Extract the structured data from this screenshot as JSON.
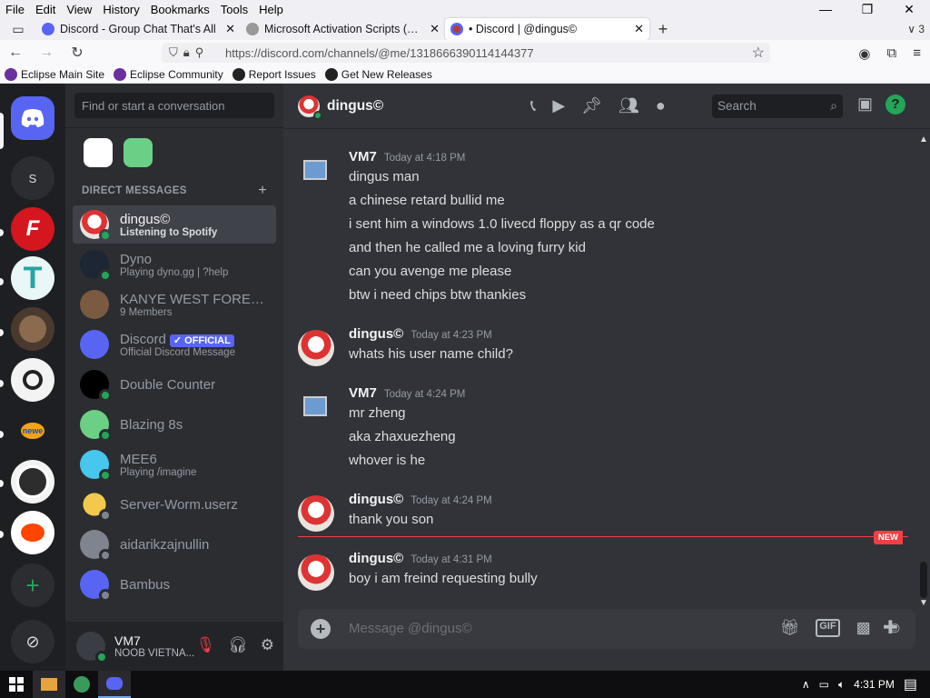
{
  "browser": {
    "menu": [
      "File",
      "Edit",
      "View",
      "History",
      "Bookmarks",
      "Tools",
      "Help"
    ],
    "tabs": [
      {
        "title": "Discord - Group Chat That's All",
        "active": false
      },
      {
        "title": "Microsoft Activation Scripts (MAS)",
        "active": false
      },
      {
        "title": "• Discord | @dingus©",
        "active": true
      }
    ],
    "tab_count": "3",
    "url": "https://discord.com/channels/@me/1318666390114144377",
    "bookmarks": [
      "Eclipse Main Site",
      "Eclipse Community",
      "Report Issues",
      "Get New Releases"
    ]
  },
  "sidebar": {
    "find_placeholder": "Find or start a conversation",
    "section_label": "DIRECT MESSAGES",
    "dms": [
      {
        "name": "dingus©",
        "sub": "Listening to Spotify",
        "selected": true,
        "status": "online"
      },
      {
        "name": "Dyno",
        "sub": "Playing dyno.gg | ?help",
        "status": "online"
      },
      {
        "name": "KANYE WEST FOREVER",
        "sub": "9 Members",
        "status": "none"
      },
      {
        "name": "Discord",
        "badge": "✓ OFFICIAL",
        "sub": "Official Discord Message",
        "status": "none"
      },
      {
        "name": "Double Counter",
        "sub": "",
        "status": "online"
      },
      {
        "name": "Blazing 8s",
        "sub": "",
        "status": "online"
      },
      {
        "name": "MEE6",
        "sub": "Playing /imagine",
        "status": "online"
      },
      {
        "name": "Server-Worm.userz",
        "sub": "",
        "status": "offline"
      },
      {
        "name": "aidarikzajnullin",
        "sub": "",
        "status": "offline"
      },
      {
        "name": "Bambus",
        "sub": "",
        "status": "offline"
      }
    ],
    "user": {
      "name": "VM7",
      "sub": "NOOB VIETNA..."
    }
  },
  "chat": {
    "title": "dingus©",
    "search_placeholder": "Search",
    "messages": [
      {
        "author": "VM7",
        "time": "Today at 4:18 PM",
        "lines": [
          "dingus man",
          "a chinese retard bullid me",
          "i sent him a windows 1.0 livecd floppy as a qr code",
          "and then he called me a loving furry kid",
          "can you avenge me please",
          "btw i need chips btw thankies"
        ]
      },
      {
        "author": "dingus©",
        "time": "Today at 4:23 PM",
        "lines": [
          "whats his user name child?"
        ]
      },
      {
        "author": "VM7",
        "time": "Today at 4:24 PM",
        "lines": [
          "mr zheng",
          "aka zhaxuezheng",
          "whover is he"
        ]
      },
      {
        "author": "dingus©",
        "time": "Today at 4:24 PM",
        "lines": [
          "thank you son"
        ]
      },
      {
        "author": "dingus©",
        "time": "Today at 4:31 PM",
        "lines": [
          "boy i am freind requesting bully"
        ]
      }
    ],
    "new_label": "NEW",
    "composer_placeholder": "Message @dingus©"
  },
  "taskbar": {
    "time": "4:31 PM"
  },
  "colors": {
    "blurple": "#5865f2",
    "online": "#23a55a",
    "offline": "#80848e",
    "new_red": "#f23f43"
  }
}
